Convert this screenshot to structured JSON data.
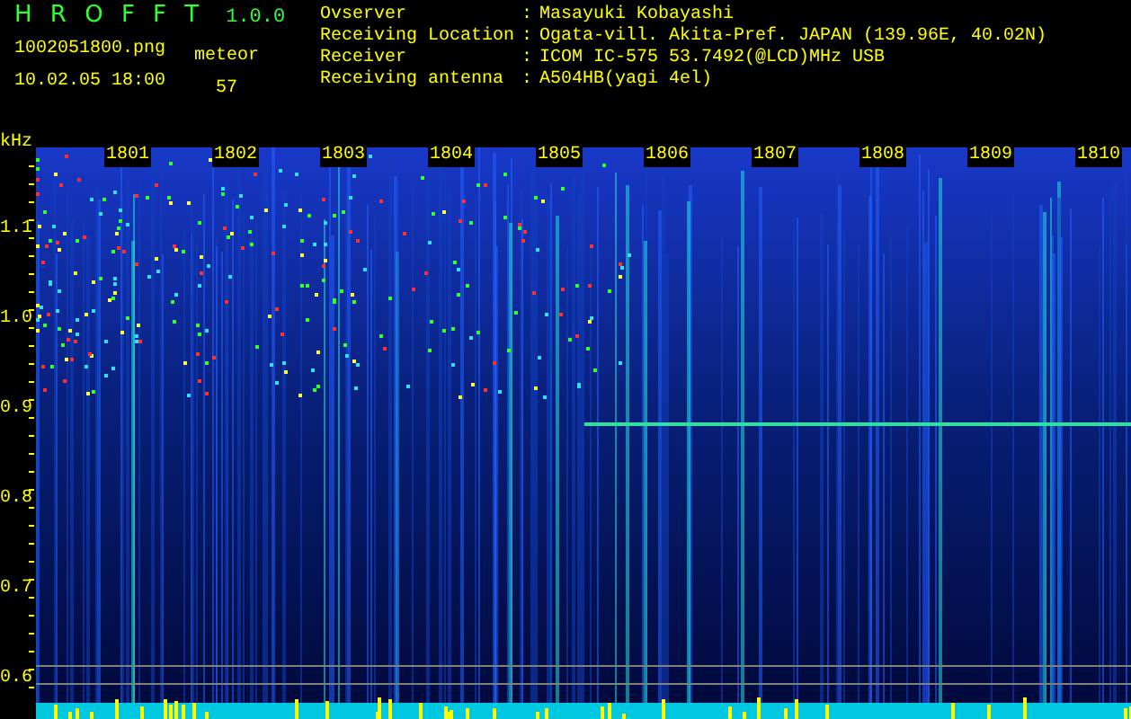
{
  "app": {
    "name": "H R O F F T",
    "version": "1.0.0"
  },
  "file": "1002051800.png",
  "datetime": "10.02.05 18:00",
  "meteor": {
    "label": "meteor",
    "count": "57"
  },
  "info": [
    {
      "label": "Ovserver",
      "separator": ":",
      "value": "Masayuki Kobayashi"
    },
    {
      "label": "Receiving Location",
      "separator": ":",
      "value": "Ogata-vill. Akita-Pref. JAPAN (139.96E, 40.02N)"
    },
    {
      "label": "Receiver",
      "separator": ":",
      "value": "ICOM IC-575 53.7492(@LCD)MHz USB"
    },
    {
      "label": "Receiving antenna",
      "separator": ":",
      "value": "A504HB(yagi 4el)"
    }
  ],
  "spectrogram": {
    "unit": "kHz",
    "minutes": [
      "1801",
      "1802",
      "1803",
      "1804",
      "1805",
      "1806",
      "1807",
      "1808",
      "1809",
      "1810"
    ],
    "frequencies": [
      "1.1",
      "1.0",
      "0.9",
      "0.8",
      "0.7",
      "0.6"
    ]
  }
}
